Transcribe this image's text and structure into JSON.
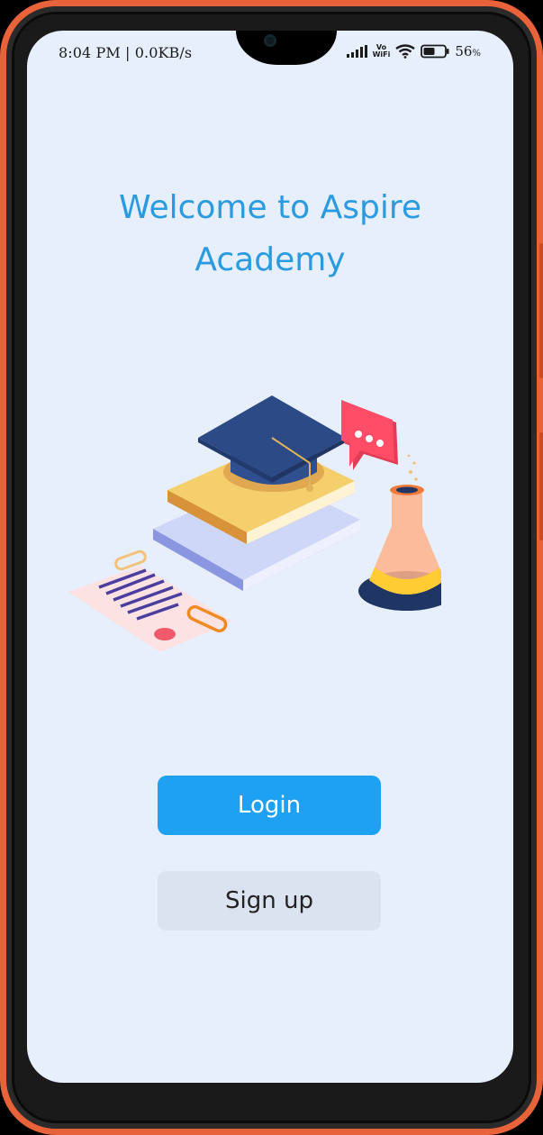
{
  "status_bar": {
    "time_speed": "8:04 PM | 0.0KB/s",
    "vowifi_top": "Vo",
    "vowifi_bottom": "WiFi",
    "battery_value": "56",
    "battery_unit": "%",
    "icons": [
      "signal-icon",
      "vowifi-icon",
      "wifi-icon",
      "battery-icon"
    ]
  },
  "welcome": {
    "title": "Welcome to Aspire Academy"
  },
  "illustration": {
    "name": "graduation-education-illustration",
    "elements": [
      "graduation-cap",
      "book-stack",
      "chat-bubble",
      "chemistry-flask",
      "certificate",
      "paper-clips"
    ]
  },
  "actions": {
    "login_label": "Login",
    "signup_label": "Sign up"
  },
  "colors": {
    "frame": "#e8623a",
    "screen_bg": "#e8effc",
    "title": "#2a9be0",
    "login_bg": "#1ea1f2",
    "signup_bg": "#dbe2f0"
  }
}
